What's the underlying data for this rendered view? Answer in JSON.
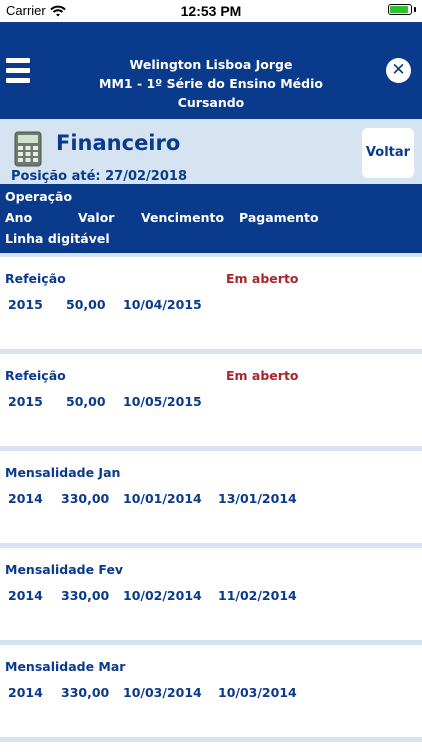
{
  "status_bar": {
    "carrier": "Carrier",
    "time": "12:53 PM"
  },
  "header": {
    "student_name": "Welington Lisboa Jorge",
    "class_info": "MM1 - 1º Série do Ensino Médio",
    "enrollment_status": "Cursando"
  },
  "finance": {
    "title": "Financeiro",
    "position_label": "Posição até:",
    "position_date": "27/02/2018",
    "back_label": "Voltar"
  },
  "columns": {
    "operation": "Operação",
    "year": "Ano",
    "value": "Valor",
    "due": "Vencimento",
    "payment": "Pagamento",
    "digital_line": "Linha digitável"
  },
  "entries": [
    {
      "description": "Refeição",
      "status": "Em aberto",
      "year": "2015",
      "value": "50,00",
      "due_date": "10/04/2015",
      "payment_date": ""
    },
    {
      "description": "Refeição",
      "status": "Em aberto",
      "year": "2015",
      "value": "50,00",
      "due_date": "10/05/2015",
      "payment_date": ""
    },
    {
      "description": "Mensalidade Jan",
      "status": "",
      "year": "2014",
      "value": "330,00",
      "due_date": "10/01/2014",
      "payment_date": "13/01/2014"
    },
    {
      "description": "Mensalidade Fev",
      "status": "",
      "year": "2014",
      "value": "330,00",
      "due_date": "10/02/2014",
      "payment_date": "11/02/2014"
    },
    {
      "description": "Mensalidade Mar",
      "status": "",
      "year": "2014",
      "value": "330,00",
      "due_date": "10/03/2014",
      "payment_date": "10/03/2014"
    }
  ],
  "colors": {
    "primary": "#0a3a8c",
    "background": "#d6e4f2",
    "open_status": "#a8262a",
    "battery": "#2ec22e"
  },
  "status_bar_battery_level": 0.9
}
